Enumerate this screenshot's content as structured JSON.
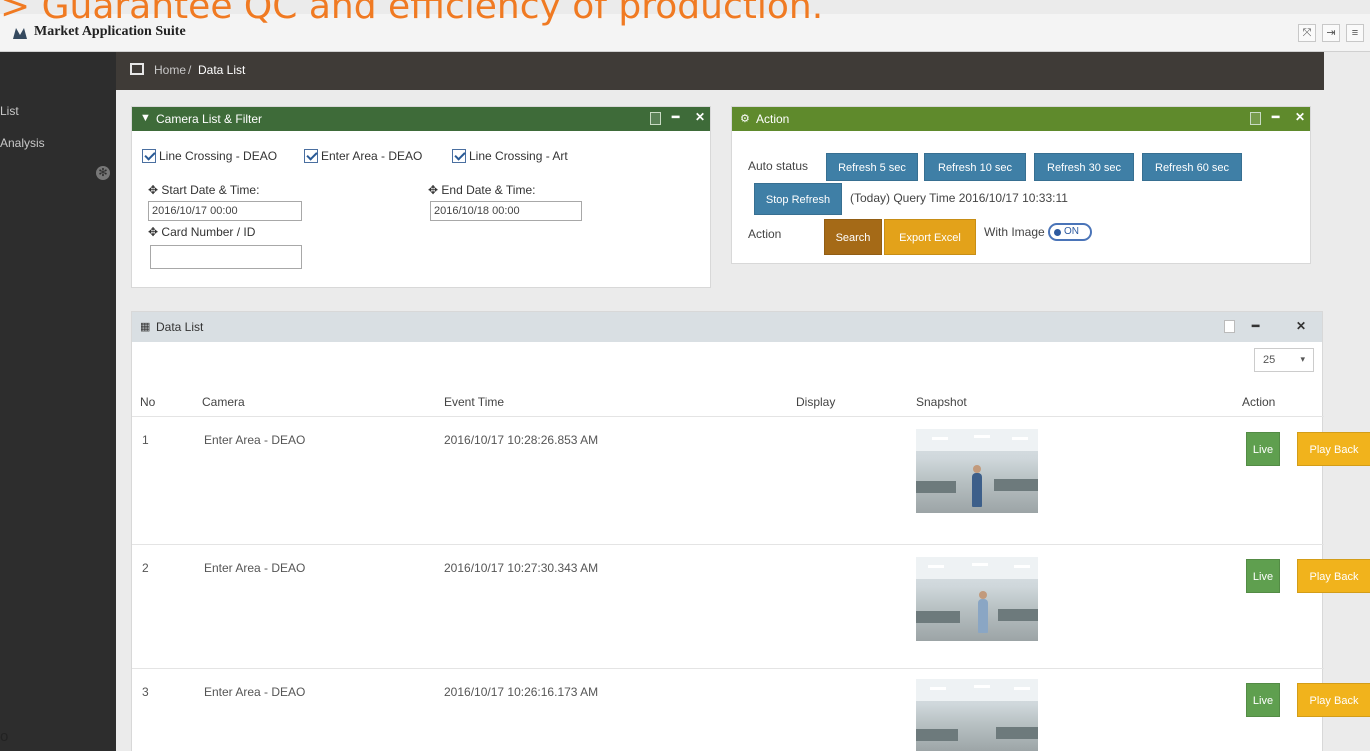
{
  "slide": {
    "headline": "> Guarantee QC and efficiency of production.",
    "stub": "o"
  },
  "app": {
    "title": "Market Application Suite",
    "window_buttons": [
      "⤧",
      "⇥",
      "≡"
    ]
  },
  "sidebar": {
    "items": [
      {
        "label": "List"
      },
      {
        "label": "Analysis"
      }
    ]
  },
  "breadcrumb": {
    "home": "Home",
    "separator": "/",
    "current": "Data List"
  },
  "filter_panel": {
    "title": "Camera List & Filter",
    "cameras": [
      {
        "label": "Line Crossing - DEAO",
        "checked": true
      },
      {
        "label": "Enter Area - DEAO",
        "checked": true
      },
      {
        "label": "Line Crossing - Art",
        "checked": true
      }
    ],
    "start_label": "Start Date & Time:",
    "start_value": "2016/10/17 00:00",
    "end_label": "End Date & Time:",
    "end_value": "2016/10/18 00:00",
    "card_label": "Card Number / ID",
    "card_value": ""
  },
  "action_panel": {
    "title": "Action",
    "auto_status_label": "Auto status",
    "refresh_buttons": [
      "Refresh 5 sec",
      "Refresh 10 sec",
      "Refresh 30 sec",
      "Refresh 60 sec"
    ],
    "stop_refresh": "Stop Refresh",
    "query_time": "(Today) Query Time 2016/10/17 10:33:11",
    "action_label": "Action",
    "search": "Search",
    "export": "Export Excel",
    "with_image": "With Image",
    "toggle": "ON"
  },
  "data_panel": {
    "title": "Data List",
    "page_size": "25",
    "columns": [
      "No",
      "Camera",
      "Event Time",
      "Display",
      "Snapshot",
      "Action"
    ],
    "rows": [
      {
        "no": "1",
        "camera": "Enter Area - DEAO",
        "time": "2016/10/17 10:28:26.853 AM",
        "display": "",
        "live": "Live",
        "playback": "Play Back"
      },
      {
        "no": "2",
        "camera": "Enter Area - DEAO",
        "time": "2016/10/17 10:27:30.343 AM",
        "display": "",
        "live": "Live",
        "playback": "Play Back"
      },
      {
        "no": "3",
        "camera": "Enter Area - DEAO",
        "time": "2016/10/17 10:26:16.173 AM",
        "display": "",
        "live": "Live",
        "playback": "Play Back"
      }
    ]
  },
  "colors": {
    "headline": "#f07a22",
    "filter_header": "#3e6b39",
    "action_header": "#5f8a2c",
    "refresh_button": "#3f7fa6",
    "search_button": "#a56a17",
    "export_button": "#e3a21a",
    "live_button": "#5f9f4f",
    "playback_button": "#f1b31c"
  }
}
